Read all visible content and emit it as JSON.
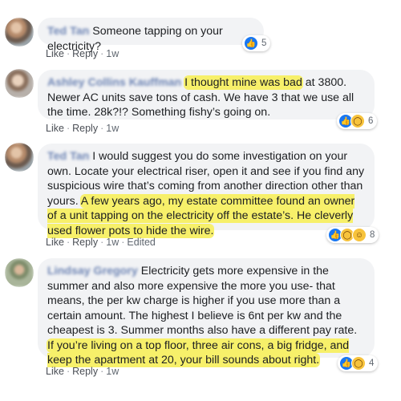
{
  "comments": [
    {
      "author": "Ted Tan",
      "segments": [
        {
          "text": "Someone tapping on your electricity?",
          "hl": false
        }
      ],
      "actions": [
        "Like",
        "Reply",
        "1w"
      ],
      "reaction_icons": [
        "like"
      ],
      "reaction_count": "5"
    },
    {
      "author": "Ashley Collins Kauffman",
      "segments": [
        {
          "text": "I thought mine was bad",
          "hl": true
        },
        {
          "text": " at 3800. Newer AC units save tons of cash. We have 3 that we use all the time. 28k?!? Something fishy’s going on.",
          "hl": false
        }
      ],
      "actions": [
        "Like",
        "Reply",
        "1w"
      ],
      "reaction_icons": [
        "like",
        "wow"
      ],
      "reaction_count": "6"
    },
    {
      "author": "Ted Tan",
      "segments": [
        {
          "text": "I would suggest you do some investigation on your own. Locate your electrical riser, open it and see if you find any suspicious wire that’s coming from another direction other than yours. ",
          "hl": false
        },
        {
          "text": "A few years ago, my estate committee found an owner of a unit tapping on the electricity off the estate’s. He cleverly used flower pots to hide the wire.",
          "hl": true
        }
      ],
      "actions": [
        "Like",
        "Reply",
        "1w",
        "Edited"
      ],
      "reaction_icons": [
        "like",
        "wow",
        "haha"
      ],
      "reaction_count": "8"
    },
    {
      "author": "Lindsay Gregory",
      "segments": [
        {
          "text": "Electricity gets more expensive in the summer and also more expensive the more you use- that means, the per kw charge is higher if you use more than a certain amount. The highest I believe is 6nt per kw and the cheapest is 3. Summer months also have a different pay rate. ",
          "hl": false
        },
        {
          "text": "If you’re living on a top floor, three air cons, a big fridge, and keep the apartment at 20, your bill sounds about right.",
          "hl": true
        }
      ],
      "actions": [
        "Like",
        "Reply",
        "1w"
      ],
      "reaction_icons": [
        "like",
        "wow"
      ],
      "reaction_count": "4"
    }
  ]
}
